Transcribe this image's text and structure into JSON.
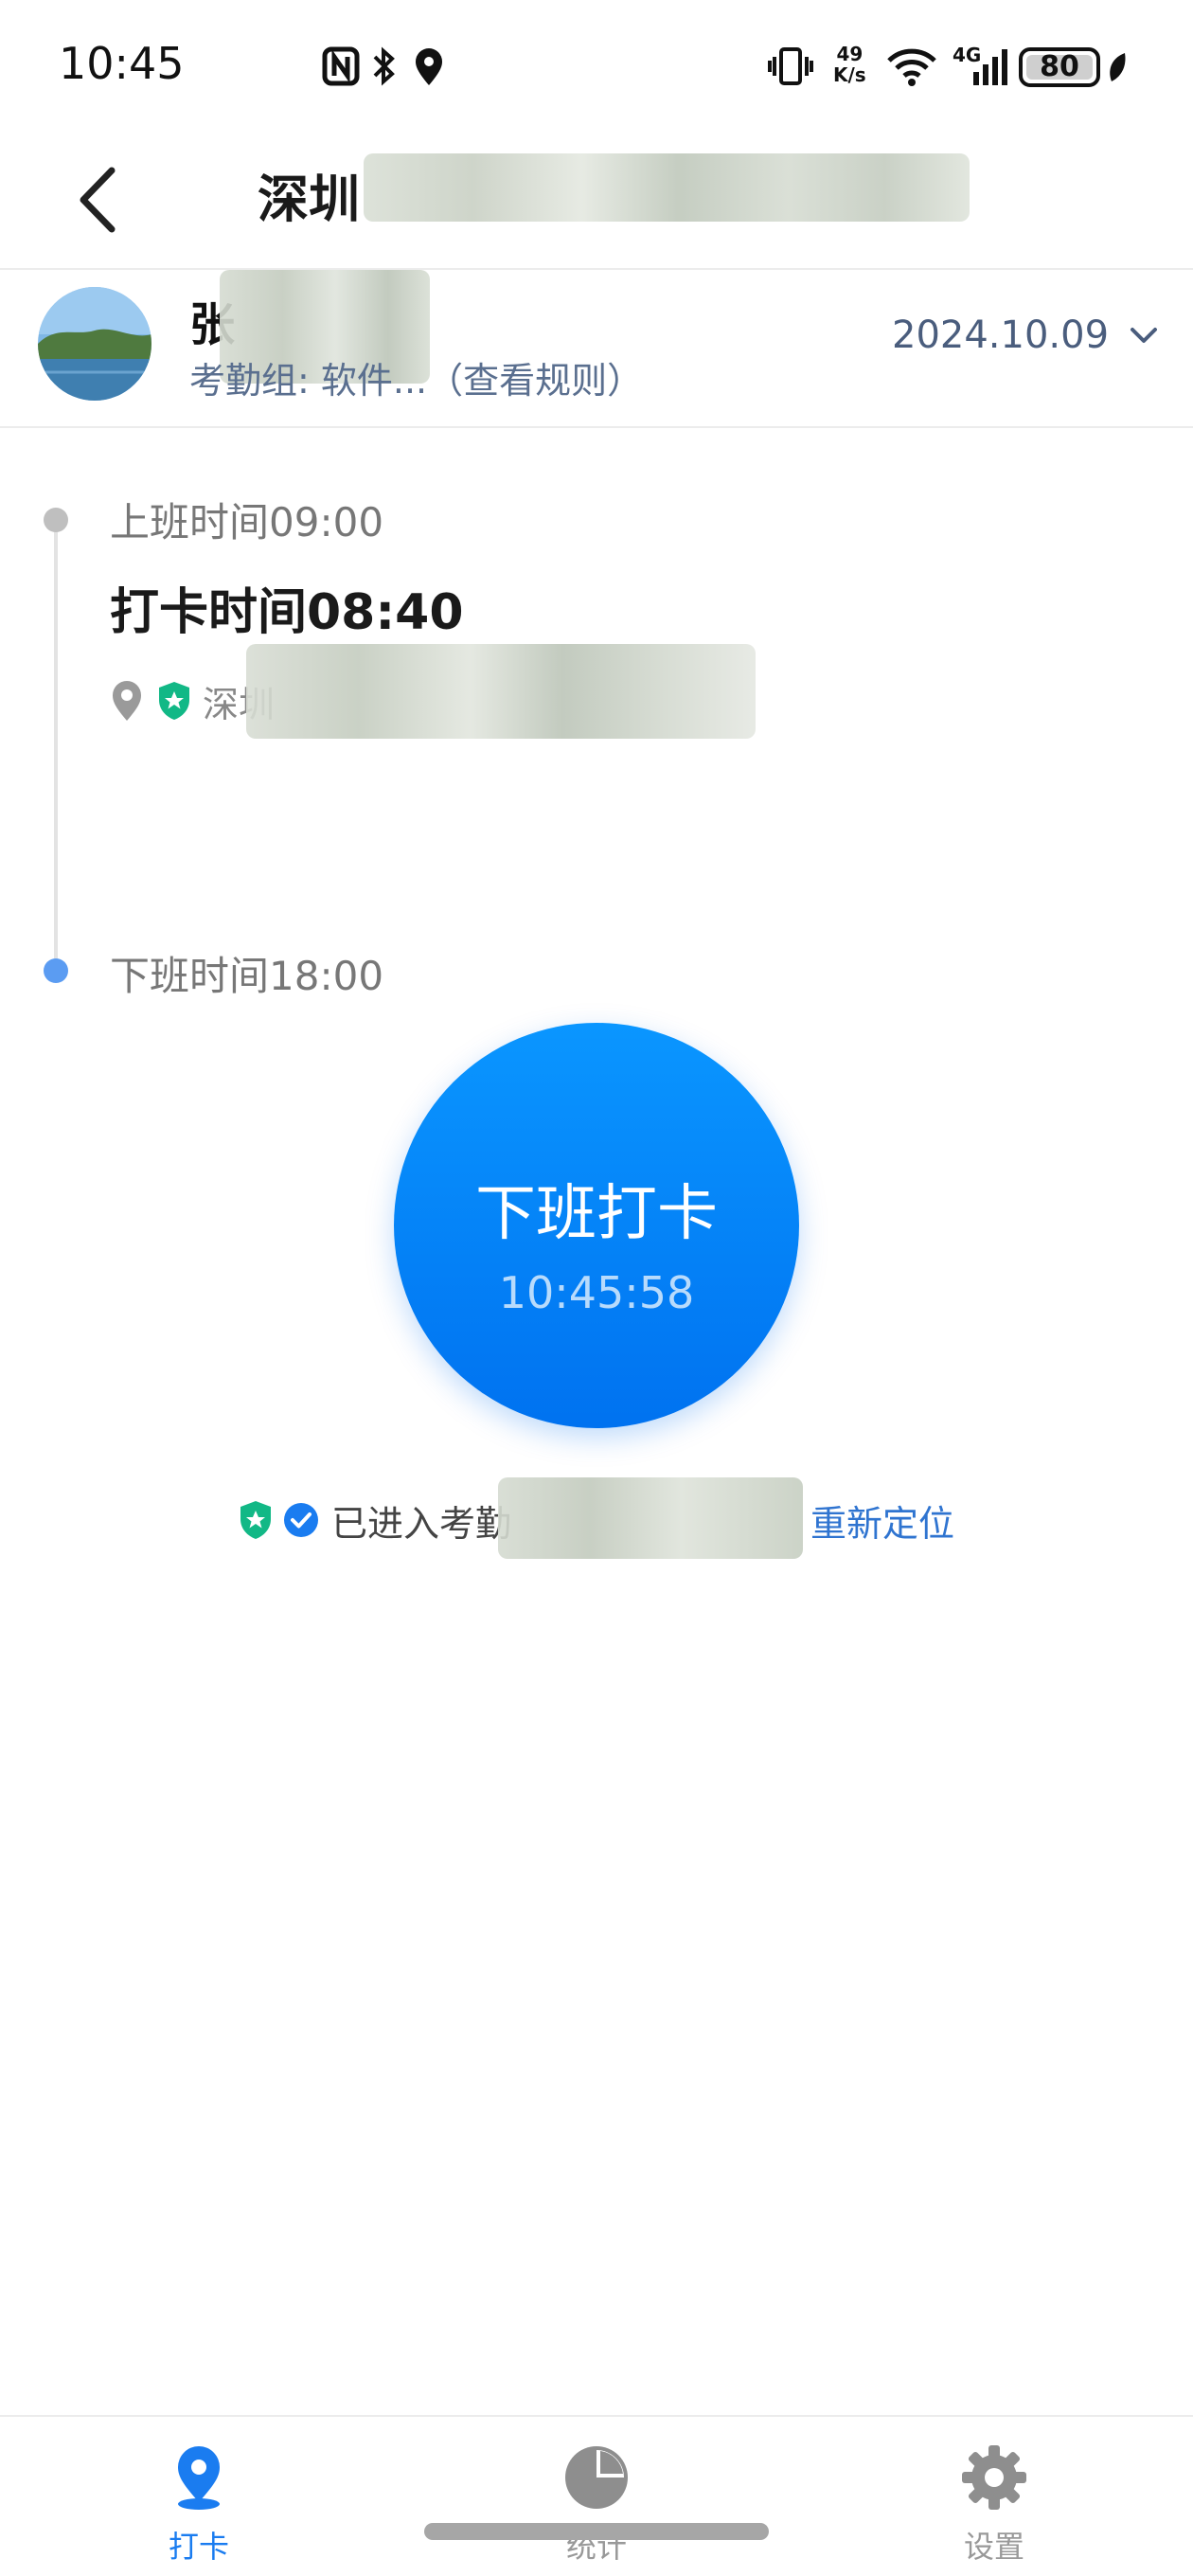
{
  "status_bar": {
    "time": "10:45",
    "net_speed_value": "49",
    "net_speed_unit": "K/s",
    "network_type": "4G",
    "battery": "80",
    "icons": [
      "nfc-icon",
      "bluetooth-icon",
      "location-icon",
      "vibrate-icon",
      "wifi-icon",
      "signal-icon",
      "battery-icon",
      "leaf-icon"
    ]
  },
  "header": {
    "title": "深圳",
    "back_icon": "chevron-left-icon"
  },
  "profile": {
    "name": "张",
    "group": "考勤组: 软件...（查看规则）",
    "date": "2024.10.09",
    "date_icon": "chevron-down-icon"
  },
  "timeline": {
    "on_duty_label": "上班时间09:00",
    "punch_time": "打卡时间08:40",
    "location": "深圳",
    "off_duty_label": "下班时间18:00"
  },
  "punch_button": {
    "label": "下班打卡",
    "clock": "10:45:58"
  },
  "geo": {
    "status_text": "已进入考勤",
    "relocate_label": "重新定位"
  },
  "bottom_nav": {
    "items": [
      {
        "label": "打卡",
        "icon": "location-pin-icon",
        "active": true
      },
      {
        "label": "统计",
        "icon": "pie-chart-icon",
        "active": false
      },
      {
        "label": "设置",
        "icon": "gear-icon",
        "active": false
      }
    ]
  },
  "colors": {
    "accent": "#0a84ff",
    "link": "#2f74d0",
    "shield": "#12b886"
  }
}
